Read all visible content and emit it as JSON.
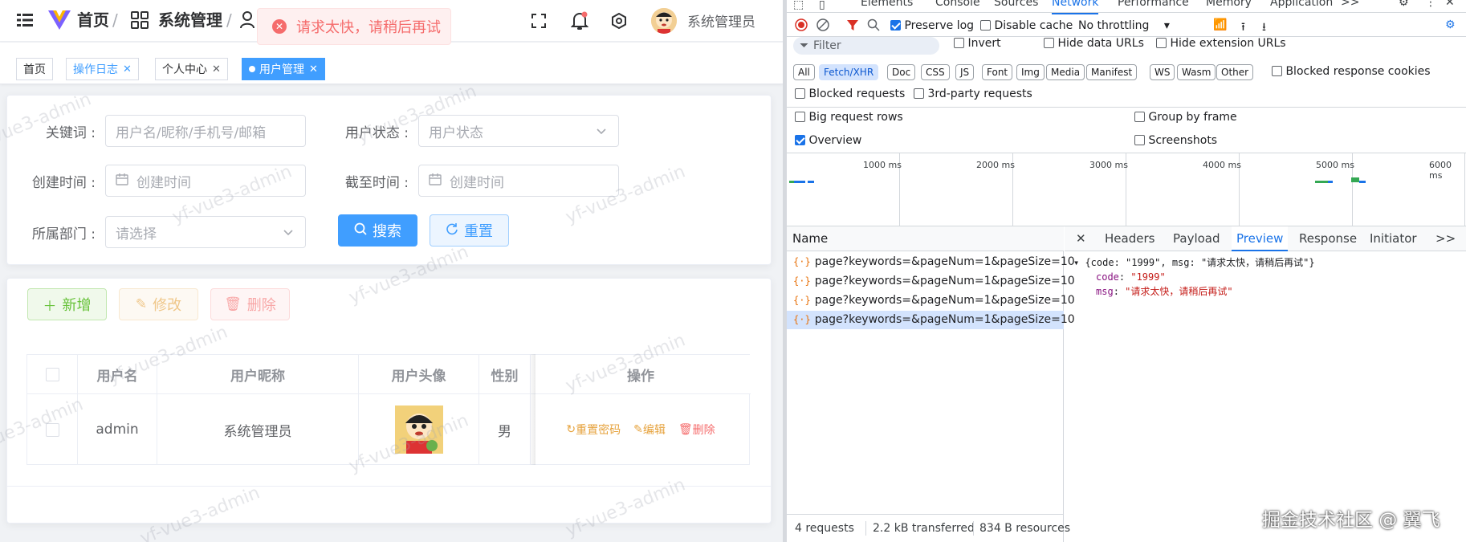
{
  "header": {
    "home": "首页",
    "breadcrumb_sep": "/",
    "system": "系统管理",
    "user_name": "系统管理员",
    "toast": "请求太快，请稍后再试",
    "icons": [
      "menu-icon",
      "logo-icon",
      "home-icon",
      "grid-icon",
      "user-icon",
      "fullscreen-icon",
      "bell-icon",
      "theme-icon"
    ]
  },
  "tags": [
    {
      "label": "首页",
      "closable": false
    },
    {
      "label": "操作日志",
      "closable": true
    },
    {
      "label": "个人中心",
      "closable": true
    },
    {
      "label": "用户管理",
      "closable": true
    }
  ],
  "close_glyph": "✕",
  "search": {
    "keyword_label": "关键词 :",
    "keyword_placeholder": "用户名/昵称/手机号/邮箱",
    "status_label": "用户状态 :",
    "status_placeholder": "用户状态",
    "created_label": "创建时间 :",
    "created_placeholder": "创建时间",
    "deadline_label": "截至时间 :",
    "deadline_placeholder": "创建时间",
    "dept_label": "所属部门 :",
    "dept_placeholder": "请选择",
    "search_btn": "搜索",
    "reset_btn": "重置"
  },
  "toolbar": {
    "add": "新增",
    "edit": "修改",
    "delete": "删除"
  },
  "table": {
    "headers": {
      "username": "用户名",
      "nickname": "用户昵称",
      "avatar": "用户头像",
      "gender": "性别",
      "actions": "操作"
    },
    "row": {
      "username": "admin",
      "nickname": "系统管理员",
      "gender": "男"
    },
    "actions": {
      "reset_pwd": "重置密码",
      "edit": "编辑",
      "delete": "删除"
    }
  },
  "watermark": "yf-vue3-admin",
  "devtools": {
    "tabs": [
      "Elements",
      "Console",
      "Sources",
      "Network",
      "Performance",
      "Memory",
      "Application"
    ],
    "more": ">>",
    "preserve_log": "Preserve log",
    "disable_cache": "Disable cache",
    "throttling": "No throttling",
    "filter": "Filter",
    "invert": "Invert",
    "hide_data_urls": "Hide data URLs",
    "hide_ext_urls": "Hide extension URLs",
    "types": [
      "All",
      "Fetch/XHR",
      "Doc",
      "CSS",
      "JS",
      "Font",
      "Img",
      "Media",
      "Manifest",
      "WS",
      "Wasm",
      "Other"
    ],
    "blocked_cookies": "Blocked response cookies",
    "blocked_requests": "Blocked requests",
    "third_party": "3rd-party requests",
    "big_rows": "Big request rows",
    "group_frame": "Group by frame",
    "overview": "Overview",
    "screenshots": "Screenshots",
    "ticks": [
      "1000 ms",
      "2000 ms",
      "3000 ms",
      "4000 ms",
      "5000 ms",
      "6000 ms"
    ],
    "name_header": "Name",
    "requests": [
      "page?keywords=&pageNum=1&pageSize=10",
      "page?keywords=&pageNum=1&pageSize=10",
      "page?keywords=&pageNum=1&pageSize=10",
      "page?keywords=&pageNum=1&pageSize=10"
    ],
    "detail_tabs": [
      "Headers",
      "Payload",
      "Preview",
      "Response",
      "Initiator"
    ],
    "preview": {
      "summary": "{code: \"1999\", msg: \"请求太快，请稍后再试\"}",
      "code_key": "code",
      "code_val": "\"1999\"",
      "msg_key": "msg",
      "msg_val": "\"请求太快，请稍后再试\""
    },
    "status": {
      "requests": "4 requests",
      "transferred": "2.2 kB transferred",
      "resources": "834 B resources"
    }
  },
  "credit": "掘金技术社区 @ 翼飞"
}
